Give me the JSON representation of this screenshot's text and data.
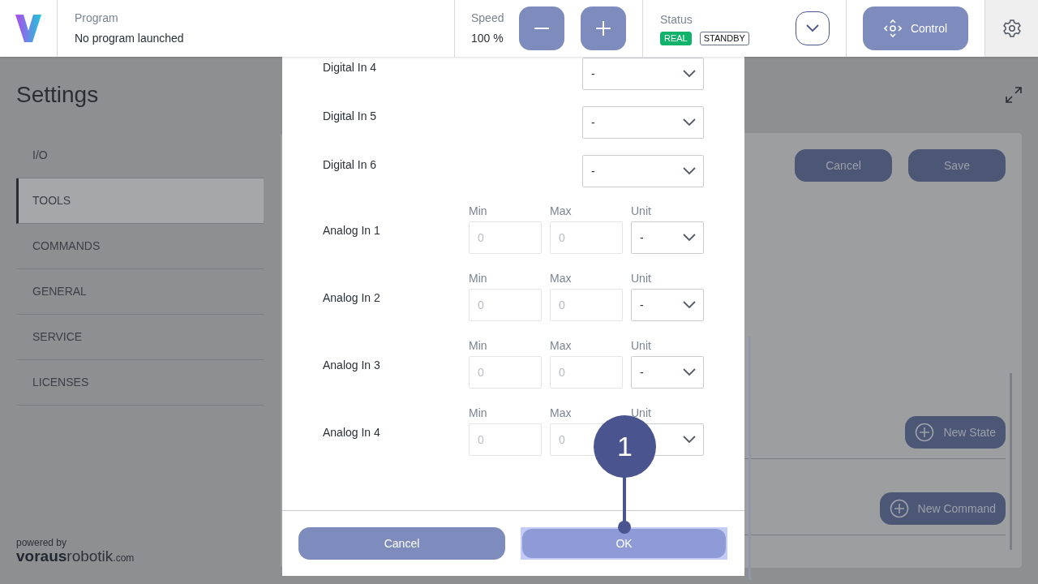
{
  "header": {
    "program": {
      "label": "Program",
      "value": "No program launched"
    },
    "speed": {
      "label": "Speed",
      "value": "100 %"
    },
    "status": {
      "label": "Status",
      "badges": [
        {
          "text": "REAL",
          "kind": "filled"
        },
        {
          "text": "STANDBY",
          "kind": "outline"
        }
      ]
    },
    "control_button": "Control"
  },
  "page": {
    "title": "Settings",
    "sidebar": [
      {
        "label": "I/O",
        "selected": false
      },
      {
        "label": "TOOLS",
        "selected": true
      },
      {
        "label": "COMMANDS",
        "selected": false
      },
      {
        "label": "GENERAL",
        "selected": false
      },
      {
        "label": "SERVICE",
        "selected": false
      },
      {
        "label": "LICENSES",
        "selected": false
      }
    ],
    "panel": {
      "cancel": "Cancel",
      "save": "Save",
      "new_state": "New State",
      "new_command": "New Command"
    },
    "footer": {
      "powered_by": "powered by",
      "brand_bold": "voraus",
      "brand_light": "robotik",
      "brand_domain": ".com"
    }
  },
  "dialog": {
    "rows": [
      {
        "kind": "select",
        "label": "Digital In 4",
        "value": "-"
      },
      {
        "kind": "select",
        "label": "Digital In 5",
        "value": "-"
      },
      {
        "kind": "select",
        "label": "Digital In 6",
        "value": "-"
      },
      {
        "kind": "range",
        "label": "Analog In 1",
        "min": {
          "label": "Min",
          "placeholder": "0"
        },
        "max": {
          "label": "Max",
          "placeholder": "0"
        },
        "unit": {
          "label": "Unit",
          "value": "-"
        }
      },
      {
        "kind": "range",
        "label": "Analog In 2",
        "min": {
          "label": "Min",
          "placeholder": "0"
        },
        "max": {
          "label": "Max",
          "placeholder": "0"
        },
        "unit": {
          "label": "Unit",
          "value": "-"
        }
      },
      {
        "kind": "range",
        "label": "Analog In 3",
        "min": {
          "label": "Min",
          "placeholder": "0"
        },
        "max": {
          "label": "Max",
          "placeholder": "0"
        },
        "unit": {
          "label": "Unit",
          "value": "-"
        }
      },
      {
        "kind": "range",
        "label": "Analog In 4",
        "min": {
          "label": "Min",
          "placeholder": "0"
        },
        "max": {
          "label": "Max",
          "placeholder": "0"
        },
        "unit": {
          "label": "Unit"
        }
      }
    ],
    "cancel": "Cancel",
    "ok": "OK",
    "tour_step": "1"
  }
}
